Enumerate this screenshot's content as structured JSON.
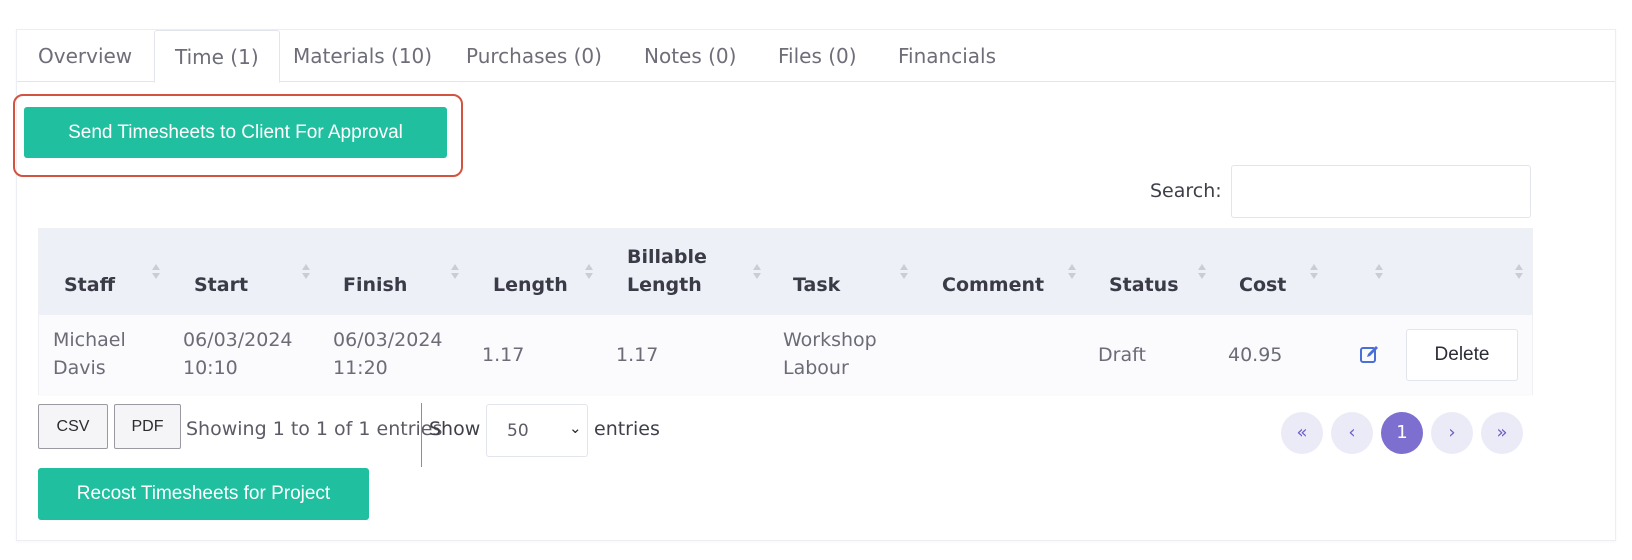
{
  "tabs": [
    {
      "label": "Overview"
    },
    {
      "label": "Time (1)"
    },
    {
      "label": "Materials (10)"
    },
    {
      "label": "Purchases (0)"
    },
    {
      "label": "Notes (0)"
    },
    {
      "label": "Files (0)"
    },
    {
      "label": "Financials"
    }
  ],
  "active_tab": "Time (1)",
  "send_button_label": "Send Timesheets to Client For Approval",
  "search": {
    "label": "Search:",
    "value": ""
  },
  "table": {
    "columns": [
      "Staff",
      "Start",
      "Finish",
      "Length",
      "Billable Length",
      "Task",
      "Comment",
      "Status",
      "Cost"
    ],
    "billable_header": {
      "line1": "Billable",
      "line2": "Length"
    },
    "rows": [
      {
        "staff": {
          "line1": "Michael",
          "line2": "Davis"
        },
        "start": {
          "line1": "06/03/2024",
          "line2": "10:10"
        },
        "finish": {
          "line1": "06/03/2024",
          "line2": "11:20"
        },
        "length": "1.17",
        "billable_length": "1.17",
        "task": {
          "line1": "Workshop",
          "line2": "Labour"
        },
        "comment": "",
        "status": "Draft",
        "cost": "40.95",
        "edit_icon": "edit-icon",
        "delete_label": "Delete"
      }
    ]
  },
  "footer": {
    "csv_label": "CSV",
    "pdf_label": "PDF",
    "info": "Showing 1 to 1 of 1 entries",
    "show_label": "Show",
    "page_size": "50",
    "entries_label": "entries"
  },
  "pagination": {
    "first": "«",
    "prev": "‹",
    "current": "1",
    "next": "›",
    "last": "»"
  },
  "recost_button_label": "Recost Timesheets for Project",
  "colors": {
    "accent_green": "#20bf9f",
    "pagination_active": "#7c6fd0",
    "highlight_border": "#d2533f",
    "header_bg": "#eef0f8",
    "edit_icon": "#4a6fd6"
  }
}
